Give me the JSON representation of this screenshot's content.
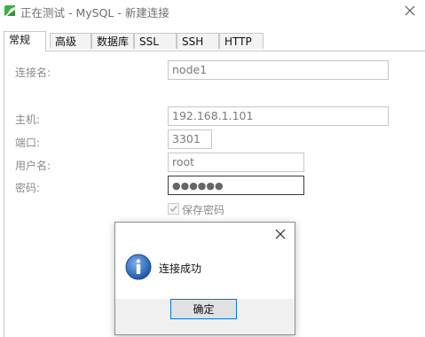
{
  "window": {
    "title": "正在测试 - MySQL - 新建连接"
  },
  "tabs": [
    {
      "label": "常规",
      "active": true
    },
    {
      "label": "高级",
      "active": false
    },
    {
      "label": "数据库",
      "active": false
    },
    {
      "label": "SSL",
      "active": false
    },
    {
      "label": "SSH",
      "active": false
    },
    {
      "label": "HTTP",
      "active": false
    }
  ],
  "form": {
    "connection_name": {
      "label": "连接名:",
      "value": "node1"
    },
    "host": {
      "label": "主机:",
      "value": "192.168.1.101"
    },
    "port": {
      "label": "端口:",
      "value": "3301"
    },
    "username": {
      "label": "用户名:",
      "value": "root"
    },
    "password": {
      "label": "密码:",
      "value": "●●●●●●"
    },
    "save_password": {
      "label": "保存密码",
      "checked": true
    }
  },
  "dialog": {
    "message": "连接成功",
    "ok_label": "确定",
    "icon": "info-icon"
  },
  "colors": {
    "app_icon": "#3cb043",
    "info_icon": "#1e56a8",
    "accent": "#0078d7"
  }
}
